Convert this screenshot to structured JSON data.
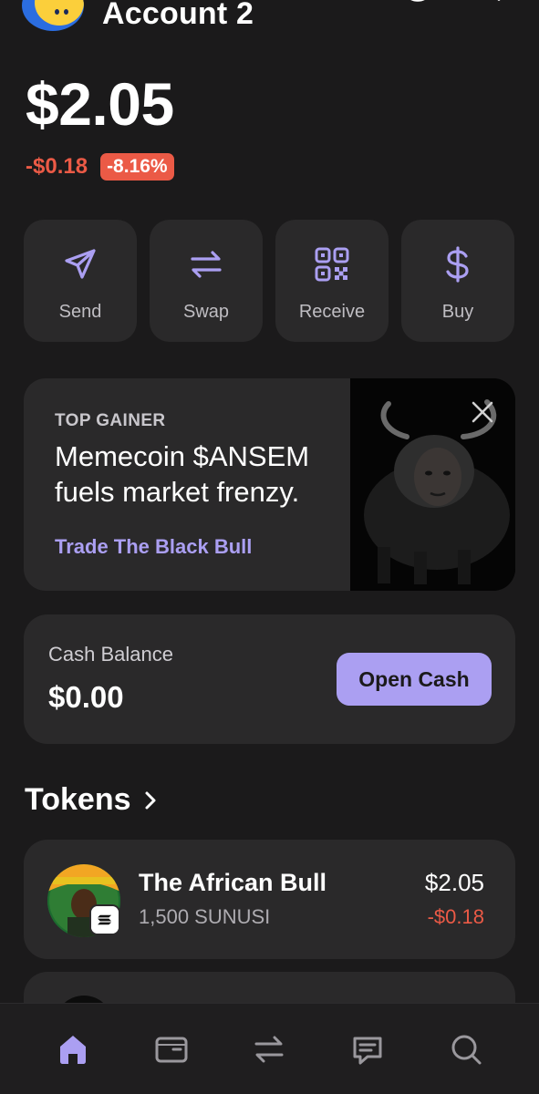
{
  "header": {
    "account_title": "Account 2",
    "icons": [
      "history-icon",
      "search-icon"
    ]
  },
  "balance": {
    "total": "$2.05",
    "change_amount": "-$0.18",
    "change_percent": "-8.16%"
  },
  "actions": [
    {
      "label": "Send",
      "icon": "send-icon"
    },
    {
      "label": "Swap",
      "icon": "swap-icon"
    },
    {
      "label": "Receive",
      "icon": "qr-code-icon"
    },
    {
      "label": "Buy",
      "icon": "dollar-icon"
    }
  ],
  "promo": {
    "tag": "TOP GAINER",
    "title_line1": "Memecoin $ANSEM",
    "title_line2": "fuels market frenzy.",
    "link": "Trade The Black Bull"
  },
  "cash": {
    "label": "Cash Balance",
    "value": "$0.00",
    "button": "Open Cash"
  },
  "tokens": {
    "title": "Tokens",
    "items": [
      {
        "name": "The African Bull",
        "amount": "1,500 SUNUSI",
        "value": "$2.05",
        "change": "-$0.18"
      }
    ]
  },
  "nav": [
    "home-icon",
    "wallet-icon",
    "swap-icon",
    "chat-icon",
    "search-icon"
  ],
  "colors": {
    "background": "#1b1a1b",
    "card": "#2a292a",
    "accent": "#ab9ff2",
    "negative": "#eb5a46"
  }
}
